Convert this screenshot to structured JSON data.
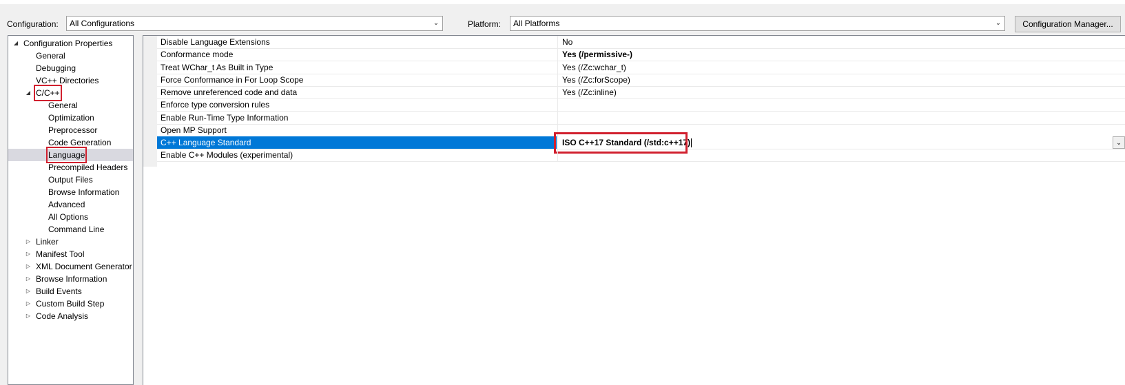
{
  "toolbar": {
    "configuration_label": "Configuration:",
    "configuration_value": "All Configurations",
    "platform_label": "Platform:",
    "platform_value": "All Platforms",
    "config_manager_button": "Configuration Manager..."
  },
  "tree": [
    {
      "label": "Configuration Properties",
      "level": 0,
      "expander": "expanded"
    },
    {
      "label": "General",
      "level": 1,
      "expander": "none"
    },
    {
      "label": "Debugging",
      "level": 1,
      "expander": "none"
    },
    {
      "label": "VC++ Directories",
      "level": 1,
      "expander": "none"
    },
    {
      "label": "C/C++",
      "level": 1,
      "expander": "expanded",
      "highlighted": true
    },
    {
      "label": "General",
      "level": 2,
      "expander": "none"
    },
    {
      "label": "Optimization",
      "level": 2,
      "expander": "none"
    },
    {
      "label": "Preprocessor",
      "level": 2,
      "expander": "none"
    },
    {
      "label": "Code Generation",
      "level": 2,
      "expander": "none"
    },
    {
      "label": "Language",
      "level": 2,
      "expander": "none",
      "selected": true,
      "highlighted": true
    },
    {
      "label": "Precompiled Headers",
      "level": 2,
      "expander": "none"
    },
    {
      "label": "Output Files",
      "level": 2,
      "expander": "none"
    },
    {
      "label": "Browse Information",
      "level": 2,
      "expander": "none"
    },
    {
      "label": "Advanced",
      "level": 2,
      "expander": "none"
    },
    {
      "label": "All Options",
      "level": 2,
      "expander": "none"
    },
    {
      "label": "Command Line",
      "level": 2,
      "expander": "none"
    },
    {
      "label": "Linker",
      "level": 1,
      "expander": "collapsed"
    },
    {
      "label": "Manifest Tool",
      "level": 1,
      "expander": "collapsed"
    },
    {
      "label": "XML Document Generator",
      "level": 1,
      "expander": "collapsed"
    },
    {
      "label": "Browse Information",
      "level": 1,
      "expander": "collapsed"
    },
    {
      "label": "Build Events",
      "level": 1,
      "expander": "collapsed"
    },
    {
      "label": "Custom Build Step",
      "level": 1,
      "expander": "collapsed"
    },
    {
      "label": "Code Analysis",
      "level": 1,
      "expander": "collapsed"
    }
  ],
  "properties": [
    {
      "name": "Disable Language Extensions",
      "value": "No",
      "bold": false
    },
    {
      "name": "Conformance mode",
      "value": "Yes (/permissive-)",
      "bold": true
    },
    {
      "name": "Treat WChar_t As Built in Type",
      "value": "Yes (/Zc:wchar_t)",
      "bold": false
    },
    {
      "name": "Force Conformance in For Loop Scope",
      "value": "Yes (/Zc:forScope)",
      "bold": false
    },
    {
      "name": "Remove unreferenced code and data",
      "value": "Yes (/Zc:inline)",
      "bold": false
    },
    {
      "name": "Enforce type conversion rules",
      "value": "",
      "bold": false
    },
    {
      "name": "Enable Run-Time Type Information",
      "value": "",
      "bold": false
    },
    {
      "name": "Open MP Support",
      "value": "",
      "bold": false
    },
    {
      "name": "C++ Language Standard",
      "value": "ISO C++17 Standard (/std:c++17)",
      "bold": true,
      "selected": true,
      "editing": true
    },
    {
      "name": "Enable C++ Modules (experimental)",
      "value": "",
      "bold": false
    }
  ],
  "colors": {
    "selection_blue": "#0078d7",
    "highlight_red": "#d1202e",
    "tree_selected": "#d9d9e0"
  },
  "icons": {
    "expanded": "triangle-expanded-icon",
    "collapsed": "triangle-collapsed-icon",
    "dropdown": "chevron-down-icon"
  }
}
